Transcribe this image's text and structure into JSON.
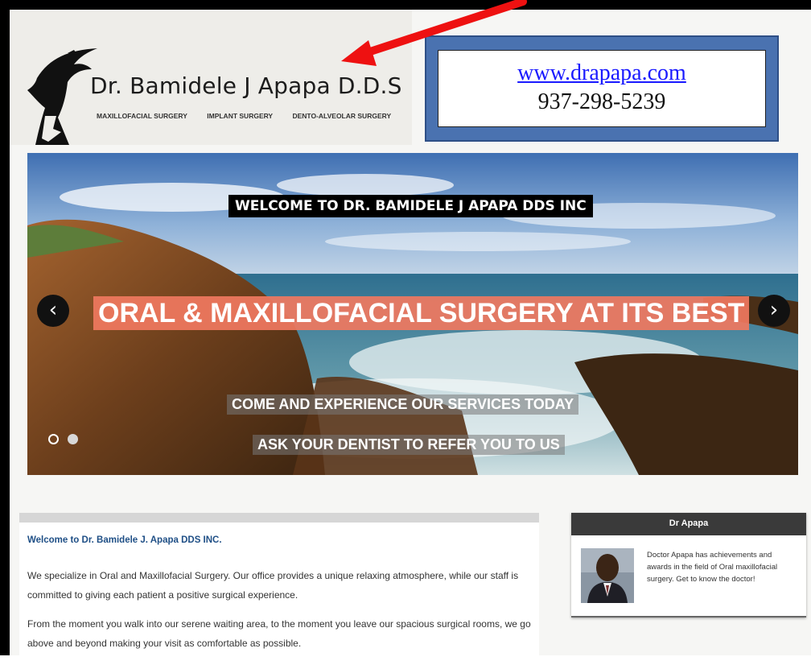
{
  "header": {
    "site_name": "Dr. Bamidele J Apapa D.D.S",
    "specialties": [
      "MAXILLOFACIAL SURGERY",
      "IMPLANT SURGERY",
      "DENTO-ALVEOLAR SURGERY"
    ],
    "contact_url": "www.drapapa.com",
    "contact_phone": "937-298-5239"
  },
  "hero": {
    "welcome": "WELCOME TO DR. BAMIDELE J APAPA DDS INC",
    "headline": "ORAL & MAXILLOFACIAL SURGERY AT ITS BEST",
    "tagline_1": "COME AND EXPERIENCE OUR SERVICES TODAY",
    "tagline_2": "ASK YOUR DENTIST TO REFER YOU TO US",
    "prev_icon": "‹",
    "next_icon": "›",
    "slide_count": 2,
    "active_slide": 1
  },
  "main": {
    "title": "Welcome to Dr. Bamidele J. Apapa DDS INC.",
    "paragraph_1": "We specialize in Oral and Maxillofacial Surgery. Our office provides a unique relaxing atmosphere, while our staff is committed to giving each patient a positive surgical experience.",
    "paragraph_2": "From the moment you walk into our serene waiting area, to the moment you leave our spacious surgical rooms, we go above and beyond making your visit as comfortable as possible."
  },
  "sidebar": {
    "heading": "Dr Apapa",
    "text": "Doctor Apapa has achievements and awards in the field of Oral maxillofacial surgery. Get to know the doctor!"
  },
  "colors": {
    "annotation_arrow": "#ee1111",
    "contact_box": "#4a72b0",
    "headline_bg": "#f0785f",
    "link_blue": "#1a1aff",
    "title_blue": "#1f4f86"
  },
  "icons": {
    "logo": "eagle-logo-icon",
    "prev": "chevron-left-icon",
    "next": "chevron-right-icon",
    "arrow": "red-arrow-icon"
  }
}
